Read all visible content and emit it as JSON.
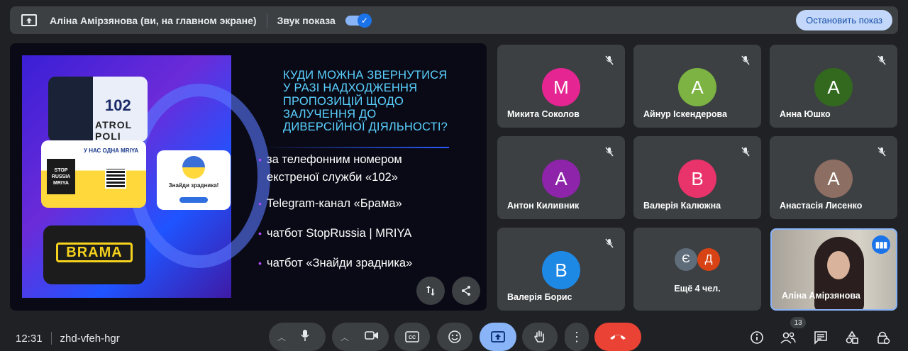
{
  "presentation_bar": {
    "title": "Аліна Амірзянова (ви, на главном экране)",
    "sound_label": "Звук показа",
    "sound_on": true,
    "stop_label": "Остановить показ"
  },
  "slide": {
    "title": "КУДИ МОЖНА ЗВЕРНУТИСЯ У РАЗІ НАДХОДЖЕННЯ ПРОПОЗИЦІЙ ЩОДО ЗАЛУЧЕННЯ ДО ДИВЕРСІЙНОЇ ДІЯЛЬНОСТІ?",
    "title_lines": [
      "КУДИ МОЖНА ЗВЕРНУТИСЯ",
      "У РАЗІ НАДХОДЖЕННЯ",
      "ПРОПОЗИЦІЙ ЩОДО",
      "ЗАЛУЧЕННЯ ДО",
      "ДИВЕРСІЙНОЇ ДІЯЛЬНОСТІ?"
    ],
    "bullets": [
      "за телефонним номером екстреної служби «102»",
      "Telegram-канал «Брама»",
      "чатбот StopRussia | MRIYA",
      "чатбот «Знайди зрадника»"
    ],
    "bullet1_line1": "за телефонним номером",
    "bullet1_line2": "екстреної служби «102»",
    "police_number": "102",
    "police_text": "ATROL POLI",
    "mriya_heading": "У НАС ОДНА MRIYA",
    "mriya_stop": "STOP RUSSIA MRIYA",
    "zradnyk_title": "Знайди зрадника!",
    "brama_logo": "BRAMA"
  },
  "participants": [
    {
      "name": "Микита Соколов",
      "initial": "М",
      "color": "#e52592"
    },
    {
      "name": "Айнур Іскендерова",
      "initial": "А",
      "color": "#7cb342"
    },
    {
      "name": "Анна Юшко",
      "initial": "А",
      "color": "#33691e"
    },
    {
      "name": "Антон Киливник",
      "initial": "А",
      "color": "#8e24aa"
    },
    {
      "name": "Валерія Калюжна",
      "initial": "В",
      "color": "#e8336b"
    },
    {
      "name": "Анастасія Лисенко",
      "initial": "А",
      "color": "#8d6e63"
    },
    {
      "name": "Валерія Борис",
      "initial": "В",
      "color": "#1e88e5"
    }
  ],
  "more_tile": {
    "label": "Ещё 4 чел.",
    "initials": [
      {
        "initial": "Є",
        "color": "#5f6d7a"
      },
      {
        "initial": "Д",
        "color": "#d84315"
      }
    ]
  },
  "self_tile": {
    "name": "Аліна Амірзянова"
  },
  "bottom": {
    "time": "12:31",
    "meeting_code": "zhd-vfeh-hgr",
    "people_count": "13"
  },
  "icons": {
    "present": "present-to-all-icon",
    "mute": "mic-off-icon",
    "mic": "mic-icon",
    "camera": "videocam-icon",
    "captions": "closed-caption-icon",
    "emoji": "emoji-icon",
    "present_now": "present-icon",
    "hand": "raise-hand-icon",
    "more": "more-vert-icon",
    "hangup": "call-end-icon",
    "info": "info-icon",
    "people": "people-icon",
    "chat": "chat-icon",
    "activities": "activities-icon",
    "host": "host-controls-icon"
  },
  "colors": {
    "accent": "#8ab4f8",
    "hangup": "#ea4335",
    "tile_bg": "#3c4043"
  }
}
